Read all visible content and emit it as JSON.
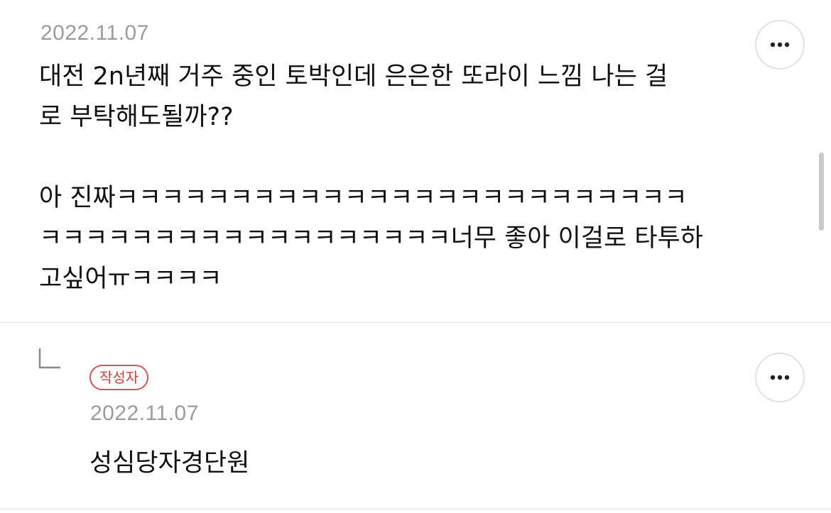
{
  "comments": [
    {
      "date": "2022.11.07",
      "body": "대전 2n년째 거주 중인 토박인데 은은한 또라이 느낌 나는 걸\n로 부탁해도될까??\n\n아 진짜ㅋㅋㅋㅋㅋㅋㅋㅋㅋㅋㅋㅋㅋㅋㅋㅋㅋㅋㅋㅋㅋㅋㅋㅋㅋ\nㅋㅋㅋㅋㅋㅋㅋㅋㅋㅋㅋㅋㅋㅋㅋㅋㅋㅋ너무 좋아 이걸로 타투하\n고싶어ㅠㅋㅋㅋㅋ",
      "more_icon": "more-horizontal-icon"
    },
    {
      "is_reply": true,
      "badge": "작성자",
      "date": "2022.11.07",
      "body": "성심당자경단원",
      "reply_icon": "reply-arrow-icon",
      "more_icon": "more-horizontal-icon"
    }
  ],
  "colors": {
    "badge": "#d0413c",
    "date": "#9b9b9b",
    "text": "#111111",
    "divider": "#e6e6e6"
  }
}
